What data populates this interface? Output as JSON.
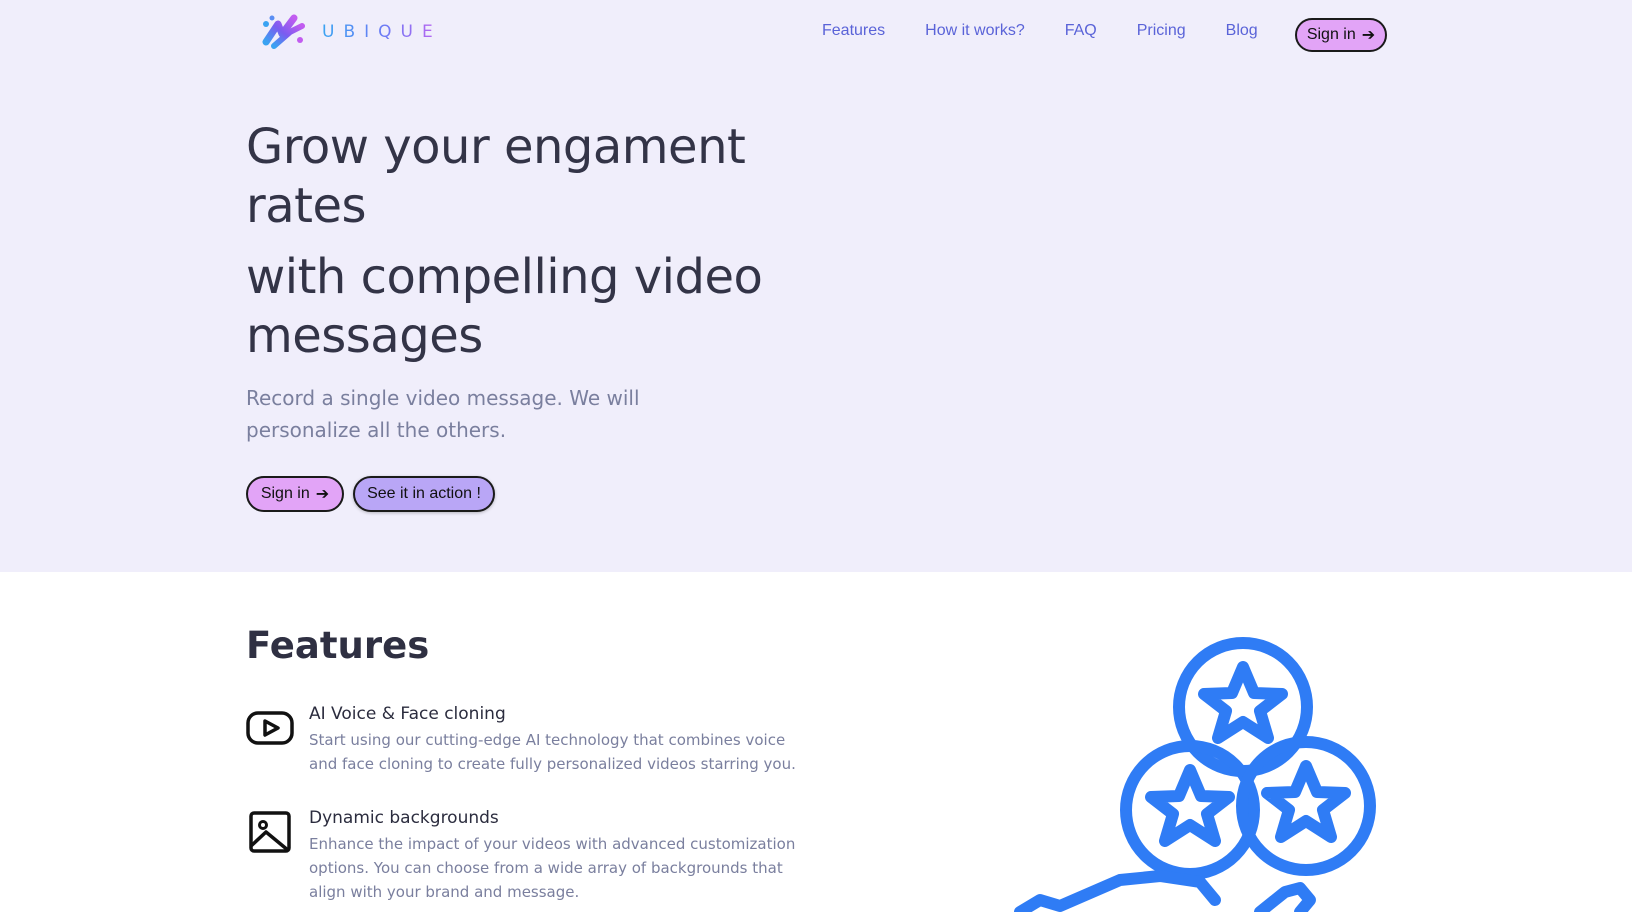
{
  "brand": {
    "name": "UBIQUE"
  },
  "nav": {
    "items": [
      {
        "label": "Features"
      },
      {
        "label": "How it works?"
      },
      {
        "label": "FAQ"
      },
      {
        "label": "Pricing"
      },
      {
        "label": "Blog"
      }
    ],
    "signin_label": "Sign in"
  },
  "hero": {
    "headline_line1": "Grow your engament rates",
    "headline_line2": "with compelling video messages",
    "subline": "Record a single video message. We will personalize all the others.",
    "signin_label": "Sign in",
    "action_label": "See it in action !"
  },
  "features": {
    "title": "Features",
    "items": [
      {
        "title": "AI Voice & Face cloning",
        "description": "Start using our cutting-edge AI technology that combines voice and face cloning to create fully personalized videos starring you.",
        "icon": "youtube-icon"
      },
      {
        "title": "Dynamic backgrounds",
        "description": "Enhance the impact of your videos with advanced customization options. You can choose from a wide array of backgrounds that align with your brand and message.",
        "icon": "image-icon"
      }
    ]
  },
  "colors": {
    "hero_bg": "#f0eefb",
    "nav_link": "#5a63d8",
    "signin_pill": "#e2a4f7",
    "action_pill": "#b9a6f6",
    "illustration": "#2f7cf5"
  },
  "illustration": {
    "icon": "stars-in-hand-icon"
  }
}
